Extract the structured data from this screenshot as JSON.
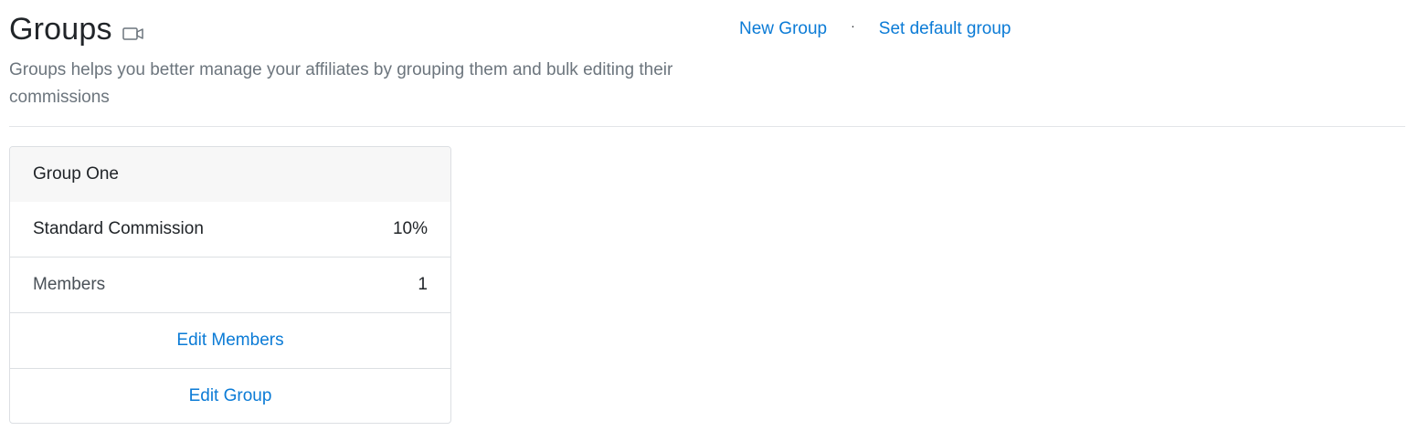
{
  "page": {
    "title": "Groups",
    "title_icon": "video-camera-icon",
    "subtitle": "Groups helps you better manage your affiliates by grouping them and bulk editing their commissions"
  },
  "actions": {
    "new_group": "New Group",
    "separator": "·",
    "set_default_group": "Set default group"
  },
  "group_card": {
    "name": "Group One",
    "rows": [
      {
        "label": "Standard Commission",
        "value": "10%"
      },
      {
        "label": "Members",
        "value": "1"
      }
    ],
    "edit_members": "Edit Members",
    "edit_group": "Edit Group"
  },
  "colors": {
    "link": "#0b7bd6",
    "muted_text": "#6c757d",
    "card_header_bg": "#f7f7f7",
    "border": "#dcdfe3"
  }
}
